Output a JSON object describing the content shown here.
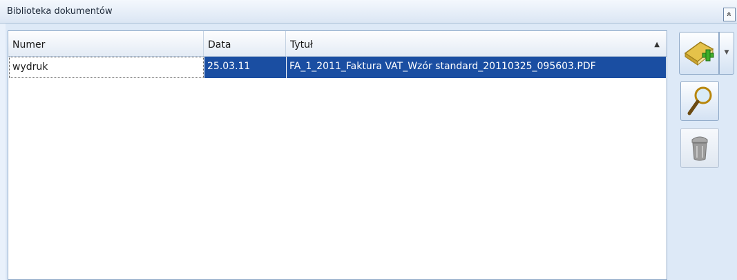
{
  "panel": {
    "title": "Biblioteka dokumentów",
    "collapse_glyph": "»"
  },
  "grid": {
    "columns": [
      "Numer",
      "Data",
      "Tytuł"
    ],
    "sort_glyph": "▲",
    "rows": [
      {
        "numer": "wydruk",
        "data": "25.03.11",
        "tytul": "FA_1_2011_Faktura VAT_Wzór standard_20110325_095603.PDF"
      }
    ]
  },
  "toolbar": {
    "add_icon": "book-add-icon",
    "preview_icon": "magnifier-icon",
    "delete_icon": "trash-bin-icon",
    "dropdown_glyph": "▼"
  },
  "colors": {
    "selection": "#1a4ea2",
    "panel_bg": "#dde9f7"
  }
}
